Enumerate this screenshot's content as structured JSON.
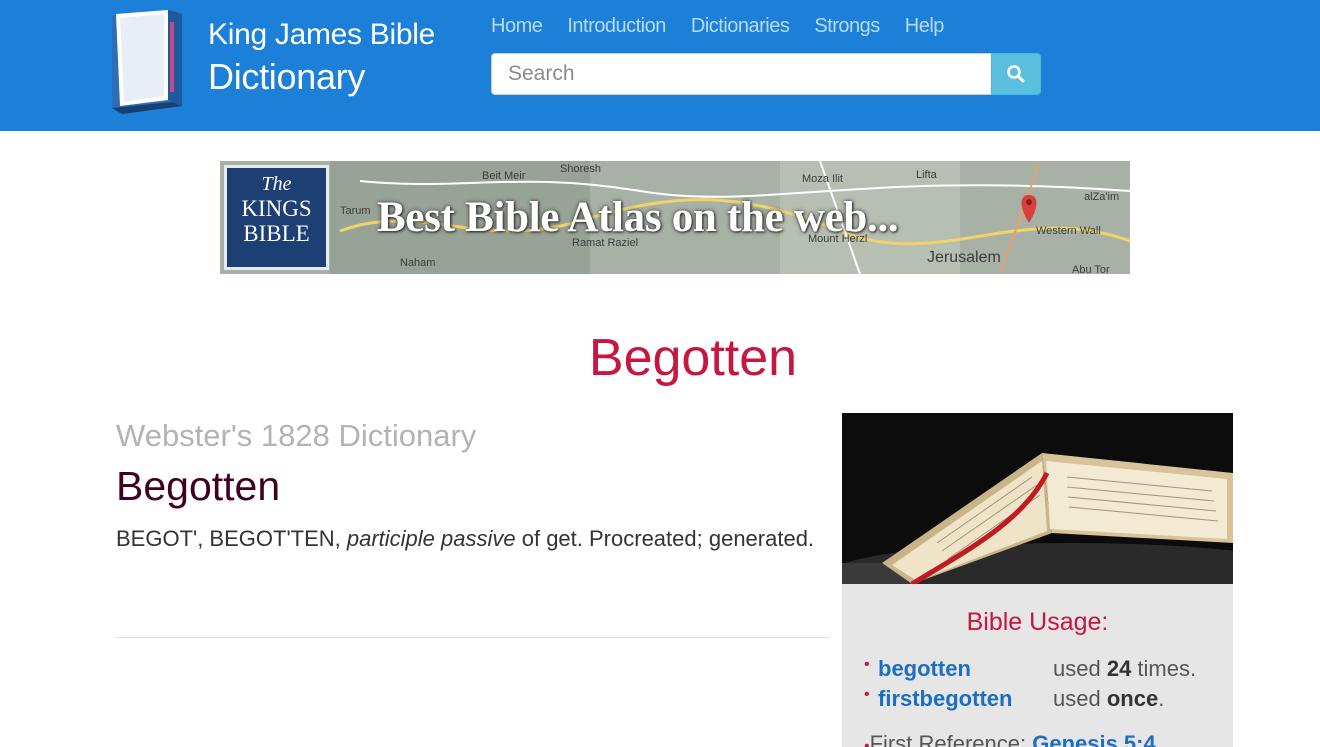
{
  "header": {
    "brand_line1": "King James Bible",
    "brand_line2": "Dictionary",
    "nav": [
      "Home",
      "Introduction",
      "Dictionaries",
      "Strongs",
      "Help"
    ],
    "search_placeholder": "Search",
    "search_icon": "search-icon",
    "colors": {
      "background": "#1c7fd8",
      "nav_text": "#b7dbf6",
      "search_button": "#5bc0de"
    }
  },
  "banner": {
    "badge_the": "The",
    "badge_kings": "KINGS",
    "badge_bible": "BIBLE",
    "text": "Best Bible Atlas on the web...",
    "map_labels": [
      "Shoresh",
      "Beit Meir",
      "Moza Ilit",
      "Lifta",
      "alZa'im",
      "Tarum",
      "Ramat Raziel",
      "Mount Herzl",
      "Western Wall",
      "Jerusalem",
      "Naham",
      "Abu Tor"
    ]
  },
  "main": {
    "title": "Begotten",
    "title_color": "#c7163f",
    "dictionary_name": "Webster's 1828 Dictionary",
    "word": "Begotten",
    "definition_pre": "BEGOT', BEGOT'TEN, ",
    "definition_em": "participle passive",
    "definition_post": " of get. Procreated; generated."
  },
  "sidebar": {
    "usage_title": "Bible Usage:",
    "usage": [
      {
        "word": "begotten",
        "prefix": "used ",
        "count": "24",
        "suffix": " times."
      },
      {
        "word": "firstbegotten",
        "prefix": "used ",
        "count": "once",
        "suffix": "."
      }
    ],
    "first_reference_label": "First Reference: ",
    "first_reference_link": "Genesis 5:4"
  }
}
